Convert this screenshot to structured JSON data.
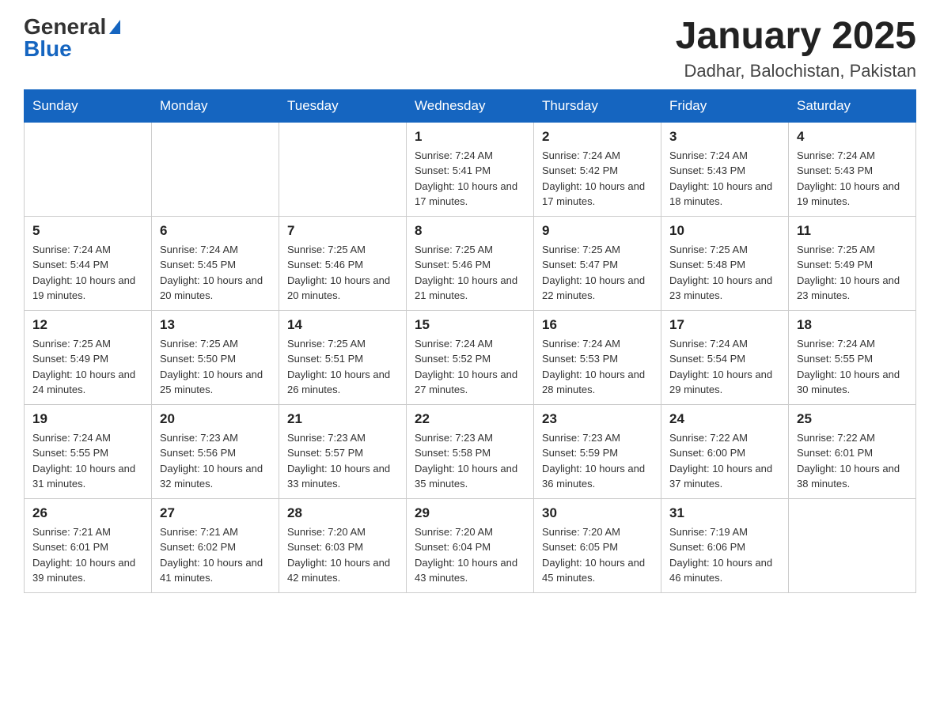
{
  "logo": {
    "general": "General",
    "blue": "Blue"
  },
  "title": "January 2025",
  "location": "Dadhar, Balochistan, Pakistan",
  "days_of_week": [
    "Sunday",
    "Monday",
    "Tuesday",
    "Wednesday",
    "Thursday",
    "Friday",
    "Saturday"
  ],
  "weeks": [
    [
      {
        "day": "",
        "sunrise": "",
        "sunset": "",
        "daylight": ""
      },
      {
        "day": "",
        "sunrise": "",
        "sunset": "",
        "daylight": ""
      },
      {
        "day": "",
        "sunrise": "",
        "sunset": "",
        "daylight": ""
      },
      {
        "day": "1",
        "sunrise": "Sunrise: 7:24 AM",
        "sunset": "Sunset: 5:41 PM",
        "daylight": "Daylight: 10 hours and 17 minutes."
      },
      {
        "day": "2",
        "sunrise": "Sunrise: 7:24 AM",
        "sunset": "Sunset: 5:42 PM",
        "daylight": "Daylight: 10 hours and 17 minutes."
      },
      {
        "day": "3",
        "sunrise": "Sunrise: 7:24 AM",
        "sunset": "Sunset: 5:43 PM",
        "daylight": "Daylight: 10 hours and 18 minutes."
      },
      {
        "day": "4",
        "sunrise": "Sunrise: 7:24 AM",
        "sunset": "Sunset: 5:43 PM",
        "daylight": "Daylight: 10 hours and 19 minutes."
      }
    ],
    [
      {
        "day": "5",
        "sunrise": "Sunrise: 7:24 AM",
        "sunset": "Sunset: 5:44 PM",
        "daylight": "Daylight: 10 hours and 19 minutes."
      },
      {
        "day": "6",
        "sunrise": "Sunrise: 7:24 AM",
        "sunset": "Sunset: 5:45 PM",
        "daylight": "Daylight: 10 hours and 20 minutes."
      },
      {
        "day": "7",
        "sunrise": "Sunrise: 7:25 AM",
        "sunset": "Sunset: 5:46 PM",
        "daylight": "Daylight: 10 hours and 20 minutes."
      },
      {
        "day": "8",
        "sunrise": "Sunrise: 7:25 AM",
        "sunset": "Sunset: 5:46 PM",
        "daylight": "Daylight: 10 hours and 21 minutes."
      },
      {
        "day": "9",
        "sunrise": "Sunrise: 7:25 AM",
        "sunset": "Sunset: 5:47 PM",
        "daylight": "Daylight: 10 hours and 22 minutes."
      },
      {
        "day": "10",
        "sunrise": "Sunrise: 7:25 AM",
        "sunset": "Sunset: 5:48 PM",
        "daylight": "Daylight: 10 hours and 23 minutes."
      },
      {
        "day": "11",
        "sunrise": "Sunrise: 7:25 AM",
        "sunset": "Sunset: 5:49 PM",
        "daylight": "Daylight: 10 hours and 23 minutes."
      }
    ],
    [
      {
        "day": "12",
        "sunrise": "Sunrise: 7:25 AM",
        "sunset": "Sunset: 5:49 PM",
        "daylight": "Daylight: 10 hours and 24 minutes."
      },
      {
        "day": "13",
        "sunrise": "Sunrise: 7:25 AM",
        "sunset": "Sunset: 5:50 PM",
        "daylight": "Daylight: 10 hours and 25 minutes."
      },
      {
        "day": "14",
        "sunrise": "Sunrise: 7:25 AM",
        "sunset": "Sunset: 5:51 PM",
        "daylight": "Daylight: 10 hours and 26 minutes."
      },
      {
        "day": "15",
        "sunrise": "Sunrise: 7:24 AM",
        "sunset": "Sunset: 5:52 PM",
        "daylight": "Daylight: 10 hours and 27 minutes."
      },
      {
        "day": "16",
        "sunrise": "Sunrise: 7:24 AM",
        "sunset": "Sunset: 5:53 PM",
        "daylight": "Daylight: 10 hours and 28 minutes."
      },
      {
        "day": "17",
        "sunrise": "Sunrise: 7:24 AM",
        "sunset": "Sunset: 5:54 PM",
        "daylight": "Daylight: 10 hours and 29 minutes."
      },
      {
        "day": "18",
        "sunrise": "Sunrise: 7:24 AM",
        "sunset": "Sunset: 5:55 PM",
        "daylight": "Daylight: 10 hours and 30 minutes."
      }
    ],
    [
      {
        "day": "19",
        "sunrise": "Sunrise: 7:24 AM",
        "sunset": "Sunset: 5:55 PM",
        "daylight": "Daylight: 10 hours and 31 minutes."
      },
      {
        "day": "20",
        "sunrise": "Sunrise: 7:23 AM",
        "sunset": "Sunset: 5:56 PM",
        "daylight": "Daylight: 10 hours and 32 minutes."
      },
      {
        "day": "21",
        "sunrise": "Sunrise: 7:23 AM",
        "sunset": "Sunset: 5:57 PM",
        "daylight": "Daylight: 10 hours and 33 minutes."
      },
      {
        "day": "22",
        "sunrise": "Sunrise: 7:23 AM",
        "sunset": "Sunset: 5:58 PM",
        "daylight": "Daylight: 10 hours and 35 minutes."
      },
      {
        "day": "23",
        "sunrise": "Sunrise: 7:23 AM",
        "sunset": "Sunset: 5:59 PM",
        "daylight": "Daylight: 10 hours and 36 minutes."
      },
      {
        "day": "24",
        "sunrise": "Sunrise: 7:22 AM",
        "sunset": "Sunset: 6:00 PM",
        "daylight": "Daylight: 10 hours and 37 minutes."
      },
      {
        "day": "25",
        "sunrise": "Sunrise: 7:22 AM",
        "sunset": "Sunset: 6:01 PM",
        "daylight": "Daylight: 10 hours and 38 minutes."
      }
    ],
    [
      {
        "day": "26",
        "sunrise": "Sunrise: 7:21 AM",
        "sunset": "Sunset: 6:01 PM",
        "daylight": "Daylight: 10 hours and 39 minutes."
      },
      {
        "day": "27",
        "sunrise": "Sunrise: 7:21 AM",
        "sunset": "Sunset: 6:02 PM",
        "daylight": "Daylight: 10 hours and 41 minutes."
      },
      {
        "day": "28",
        "sunrise": "Sunrise: 7:20 AM",
        "sunset": "Sunset: 6:03 PM",
        "daylight": "Daylight: 10 hours and 42 minutes."
      },
      {
        "day": "29",
        "sunrise": "Sunrise: 7:20 AM",
        "sunset": "Sunset: 6:04 PM",
        "daylight": "Daylight: 10 hours and 43 minutes."
      },
      {
        "day": "30",
        "sunrise": "Sunrise: 7:20 AM",
        "sunset": "Sunset: 6:05 PM",
        "daylight": "Daylight: 10 hours and 45 minutes."
      },
      {
        "day": "31",
        "sunrise": "Sunrise: 7:19 AM",
        "sunset": "Sunset: 6:06 PM",
        "daylight": "Daylight: 10 hours and 46 minutes."
      },
      {
        "day": "",
        "sunrise": "",
        "sunset": "",
        "daylight": ""
      }
    ]
  ]
}
